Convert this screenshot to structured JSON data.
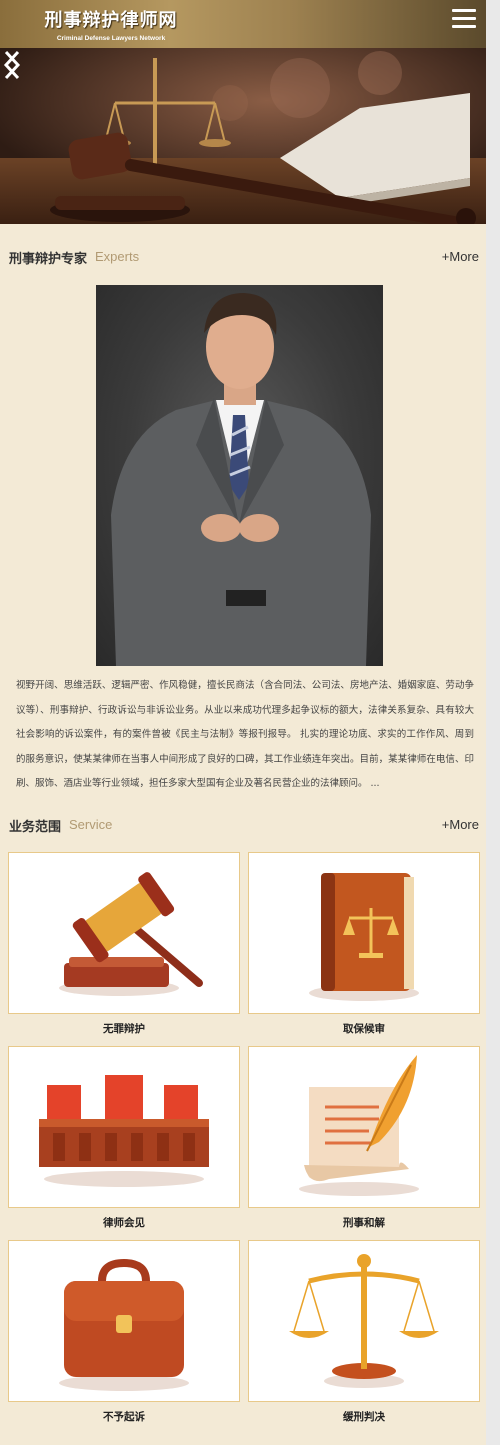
{
  "header": {
    "logo_cn": "刑事辩护律师网",
    "logo_en": "Criminal Defense Lawyers Network"
  },
  "icons": {
    "menu": "hamburger-menu-icon",
    "prev": "chevron-left-icon",
    "next": "chevron-right-icon"
  },
  "experts": {
    "title_cn": "刑事辩护专家",
    "title_en": "Experts",
    "more": "+More",
    "description": "视野开阔、思维活跃、逻辑严密、作风稳健，擅长民商法（含合同法、公司法、房地产法、婚姻家庭、劳动争议等）、刑事辩护、行政诉讼与非诉讼业务。从业以来成功代理多起争议标的额大，法律关系复杂、具有较大社会影响的诉讼案件，有的案件曾被《民主与法制》等报刊报导。 扎实的理论功底、求实的工作作风、周到的服务意识，使某某律师在当事人中间形成了良好的口碑，其工作业绩连年突出。目前，某某律师在电信、印刷、服饰、酒店业等行业领域，担任多家大型国有企业及著名民营企业的法律顾问。 ..."
  },
  "services": {
    "title_cn": "业务范围",
    "title_en": "Service",
    "more": "+More",
    "items": [
      {
        "label": "无罪辩护",
        "icon": "gavel-icon"
      },
      {
        "label": "取保候审",
        "icon": "law-book-icon"
      },
      {
        "label": "律师会见",
        "icon": "court-seats-icon"
      },
      {
        "label": "刑事和解",
        "icon": "scroll-quill-icon"
      },
      {
        "label": "不予起诉",
        "icon": "briefcase-icon"
      },
      {
        "label": "缓刑判决",
        "icon": "scales-icon"
      }
    ]
  },
  "colors": {
    "background": "#f3ead6",
    "header": "#9d8150",
    "accent_en": "#b19a73",
    "card_border": "#e8c98a"
  }
}
